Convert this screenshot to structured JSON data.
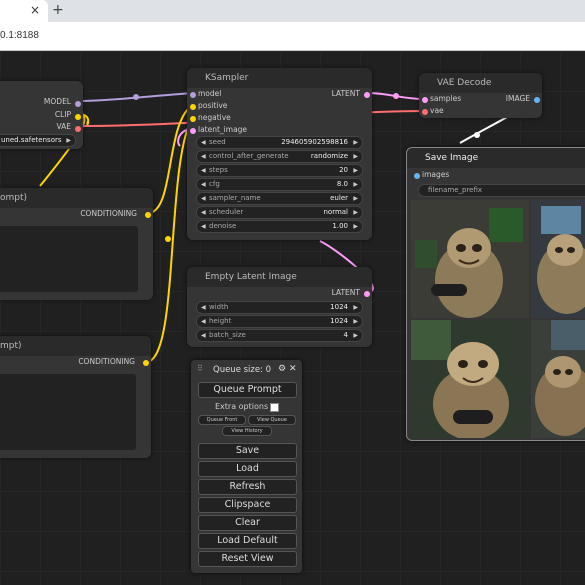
{
  "browser": {
    "tab_close": "×",
    "new_tab": "+",
    "url": "0.1:8188"
  },
  "checkpoint_node": {
    "outputs": [
      "MODEL",
      "CLIP",
      "VAE"
    ],
    "ckpt_name": "uned.safetensors"
  },
  "prompt_pos": {
    "title": "ompt)",
    "output": "CONDITIONING"
  },
  "prompt_neg": {
    "title": "mpt)",
    "output": "CONDITIONING"
  },
  "ksampler": {
    "title": "KSampler",
    "inputs": [
      "model",
      "positive",
      "negative",
      "latent_image"
    ],
    "output": "LATENT",
    "widgets": [
      {
        "label": "seed",
        "value": "294605902598816"
      },
      {
        "label": "control_after_generate",
        "value": "randomize"
      },
      {
        "label": "steps",
        "value": "20"
      },
      {
        "label": "cfg",
        "value": "8.0"
      },
      {
        "label": "sampler_name",
        "value": "euler"
      },
      {
        "label": "scheduler",
        "value": "normal"
      },
      {
        "label": "denoise",
        "value": "1.00"
      }
    ]
  },
  "vae_decode": {
    "title": "VAE Decode",
    "inputs": [
      "samples",
      "vae"
    ],
    "output": "IMAGE"
  },
  "empty_latent": {
    "title": "Empty Latent Image",
    "output": "LATENT",
    "widgets": [
      {
        "label": "width",
        "value": "1024"
      },
      {
        "label": "height",
        "value": "1024"
      },
      {
        "label": "batch_size",
        "value": "4"
      }
    ]
  },
  "save_image": {
    "title": "Save Image",
    "input": "images",
    "widget_label": "filename_prefix"
  },
  "queue_panel": {
    "queue_size": "Queue size: 0",
    "queue_prompt": "Queue Prompt",
    "extra_options": "Extra options",
    "queue_front": "Queue Front",
    "view_queue": "View Queue",
    "view_history": "View History",
    "buttons": [
      "Save",
      "Load",
      "Refresh",
      "Clipspace",
      "Clear",
      "Load Default",
      "Reset View"
    ]
  },
  "colors": {
    "model_wire": "#b39ddb",
    "clip_wire": "#ffd500",
    "vae_wire": "#ff6e6e",
    "latent_wire": "#ff9cf9",
    "image_wire": "#64b5f6"
  }
}
